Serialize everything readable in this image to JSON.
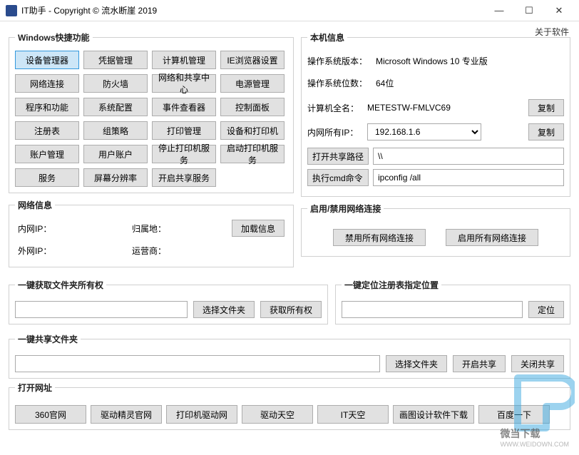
{
  "window": {
    "title": "IT助手 - Copyright © 流水断崖 2019",
    "about": "关于软件"
  },
  "shortcuts": {
    "legend": "Windows快捷功能",
    "buttons": [
      "设备管理器",
      "凭据管理",
      "计算机管理",
      "IE浏览器设置",
      "网络连接",
      "防火墙",
      "网络和共享中心",
      "电源管理",
      "程序和功能",
      "系统配置",
      "事件查看器",
      "控制面板",
      "注册表",
      "组策略",
      "打印管理",
      "设备和打印机",
      "账户管理",
      "用户账户",
      "停止打印机服务",
      "启动打印机服务",
      "服务",
      "屏幕分辨率",
      "开启共享服务"
    ]
  },
  "localInfo": {
    "legend": "本机信息",
    "osVersionLabel": "操作系统版本：",
    "osVersion": "Microsoft Windows 10 专业版",
    "osBitLabel": "操作系统位数：",
    "osBit": "64位",
    "pcNameLabel": "计算机全名：",
    "pcName": "METESTW-FMLVC69",
    "copy": "复制",
    "ipLabel": "内网所有IP：",
    "ip": "192.168.1.6",
    "sharePathBtn": "打开共享路径",
    "sharePathVal": "\\\\",
    "cmdBtn": "执行cmd命令",
    "cmdVal": "ipconfig /all"
  },
  "netInfo": {
    "legend": "网络信息",
    "innerIpLabel": "内网IP：",
    "locationLabel": "归属地：",
    "outerIpLabel": "外网IP：",
    "ispLabel": "运营商：",
    "loadBtn": "加载信息"
  },
  "netToggle": {
    "legend": "启用/禁用网络连接",
    "disableAll": "禁用所有网络连接",
    "enableAll": "启用所有网络连接"
  },
  "folderOwn": {
    "legend": "一键获取文件夹所有权",
    "chooseFolder": "选择文件夹",
    "getOwn": "获取所有权"
  },
  "regLocate": {
    "legend": "一键定位注册表指定位置",
    "locate": "定位"
  },
  "shareFolder": {
    "legend": "一键共享文件夹",
    "chooseFolder": "选择文件夹",
    "openShare": "开启共享",
    "closeShare": "关闭共享"
  },
  "urls": {
    "legend": "打开网址",
    "buttons": [
      "360官网",
      "驱动精灵官网",
      "打印机驱动网",
      "驱动天空",
      "IT天空",
      "画图设计软件下载",
      "百度一下"
    ]
  },
  "watermark": {
    "text1": "微当下载",
    "text2": "WWW.WEIDOWN.COM"
  }
}
